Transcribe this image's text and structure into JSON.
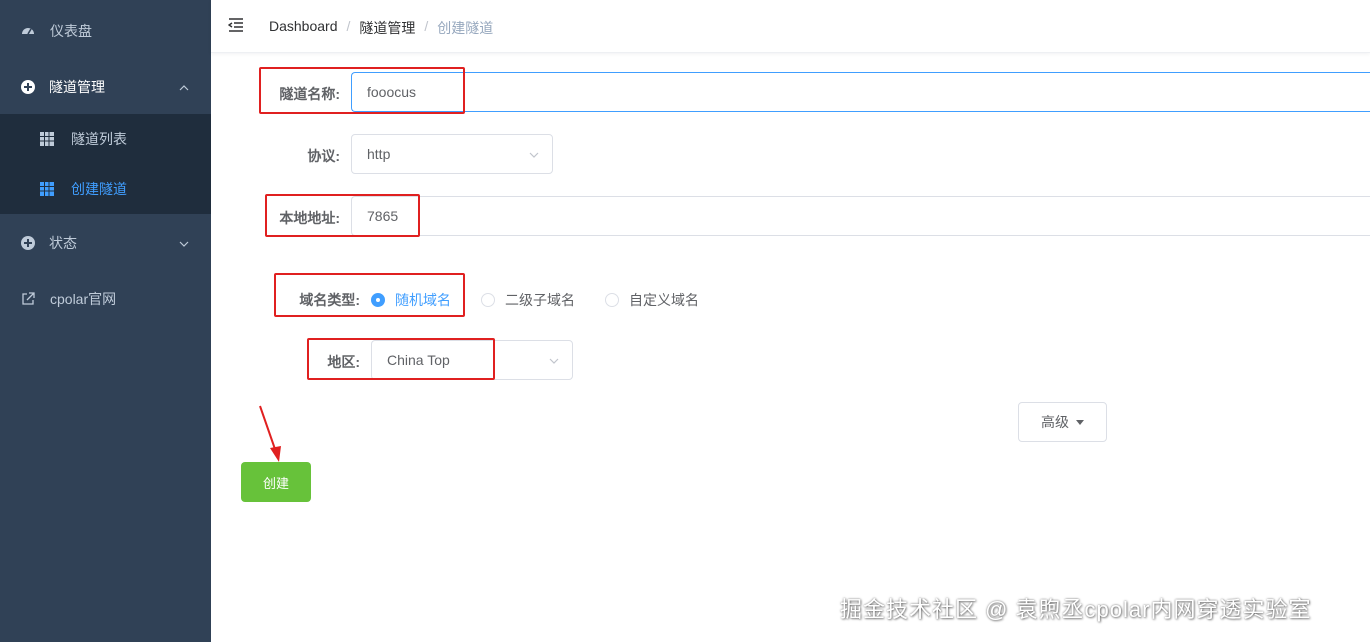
{
  "sidebar": {
    "items": [
      {
        "label": "仪表盘",
        "icon": "dashboard-icon"
      },
      {
        "label": "隧道管理",
        "icon": "tunnel-management-icon",
        "expanded": true
      },
      {
        "label": "状态",
        "icon": "status-icon"
      },
      {
        "label": "cpolar官网",
        "icon": "external-link-icon"
      }
    ],
    "sub_items": [
      {
        "label": "隧道列表",
        "icon": "table-icon"
      },
      {
        "label": "创建隧道",
        "icon": "table-icon",
        "active": true
      }
    ]
  },
  "header": {
    "breadcrumbs": [
      "Dashboard",
      "隧道管理",
      "创建隧道"
    ],
    "separator": "/"
  },
  "form": {
    "tunnel_name": {
      "label": "隧道名称:",
      "value": "fooocus"
    },
    "protocol": {
      "label": "协议:",
      "value": "http"
    },
    "local_address": {
      "label": "本地地址:",
      "value": "7865"
    },
    "domain_type": {
      "label": "域名类型:",
      "options": [
        "随机域名",
        "二级子域名",
        "自定义域名"
      ],
      "selected": "随机域名"
    },
    "region": {
      "label": "地区:",
      "value": "China Top"
    },
    "advanced_label": "高级",
    "create_label": "创建"
  },
  "watermark": "掘金技术社区 @ 袁煦丞cpolar内网穿透实验室",
  "colors": {
    "sidebar_bg": "#304156",
    "submenu_bg": "#1f2d3d",
    "accent": "#409eff",
    "primary_button": "#67c23a",
    "annotation": "#e02020"
  }
}
